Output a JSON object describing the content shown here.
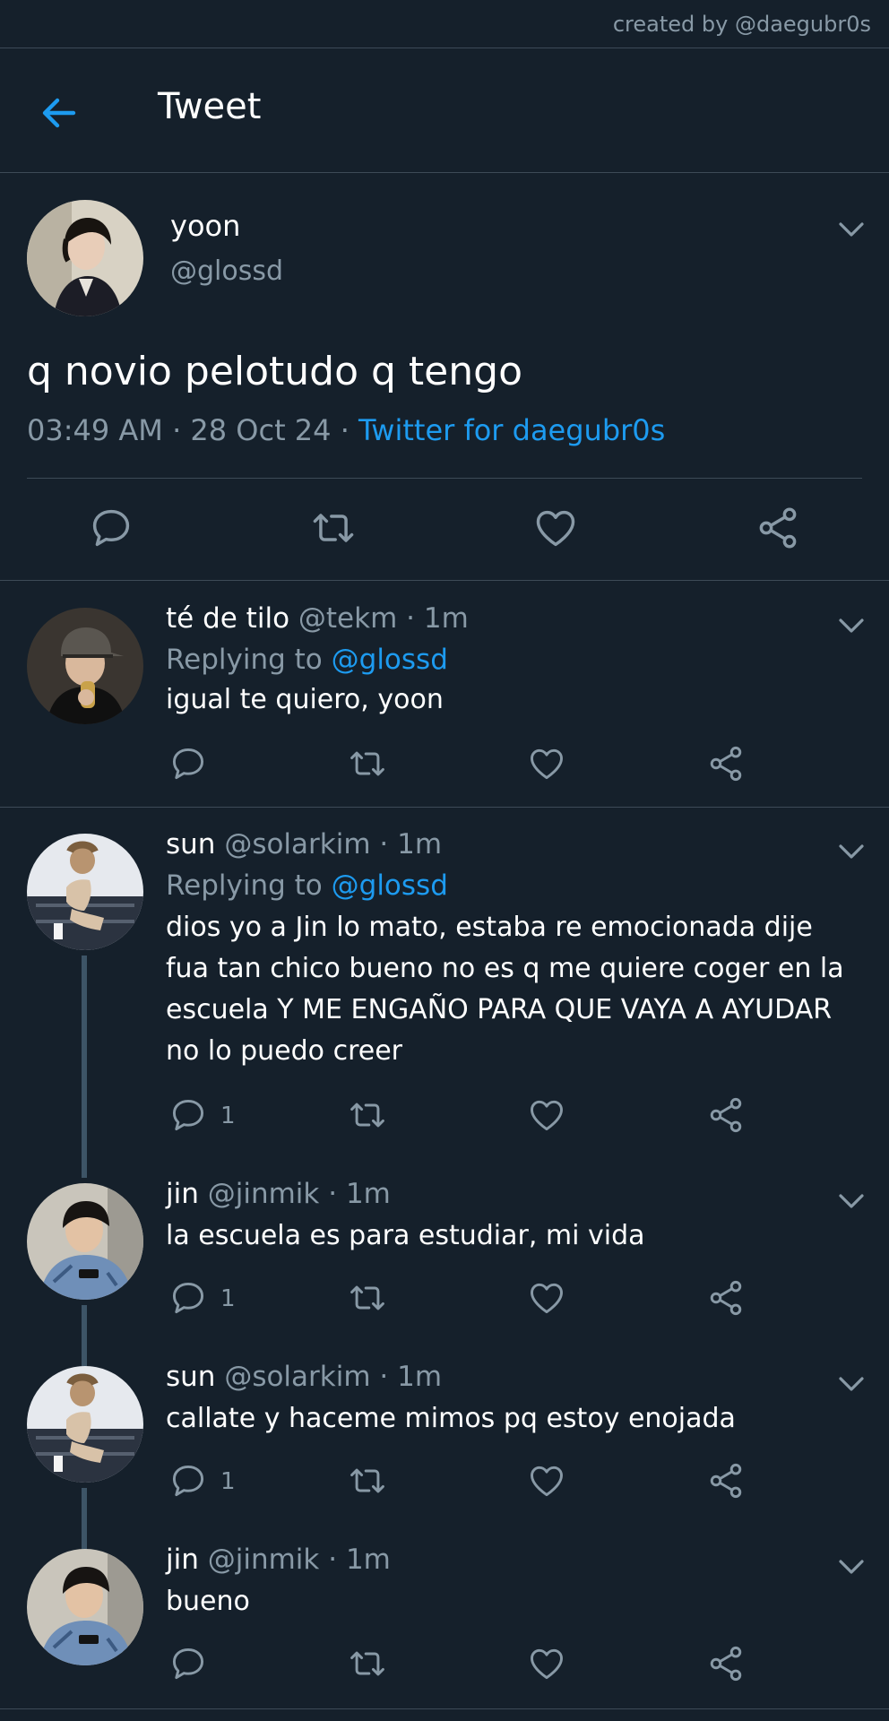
{
  "credit": "created by @daegubr0s",
  "header": {
    "title": "Tweet"
  },
  "main_tweet": {
    "name": "yoon",
    "handle": "@glossd",
    "text": "q novio pelotudo q tengo",
    "time": "03:49 AM",
    "date": "28 Oct 24",
    "sep": "·",
    "source": "Twitter for daegubr0s"
  },
  "replies": [
    {
      "name": "té de tilo",
      "handle": "@tekm",
      "time": "1m",
      "replying_prefix": "Replying to",
      "replying_to": "@glossd",
      "text": "igual te quiero, yoon",
      "reply_count": ""
    },
    {
      "name": "sun",
      "handle": "@solarkim",
      "time": "1m",
      "replying_prefix": "Replying to",
      "replying_to": "@glossd",
      "text": "dios yo a Jin lo mato, estaba re emocionada dije fua tan chico bueno no es q me quiere coger en la escuela Y ME ENGAÑO PARA QUE VAYA A AYUDAR no lo puedo creer",
      "reply_count": "1"
    },
    {
      "name": "jin",
      "handle": "@jinmik",
      "time": "1m",
      "text": "la escuela es para estudiar, mi vida",
      "reply_count": "1"
    },
    {
      "name": "sun",
      "handle": "@solarkim",
      "time": "1m",
      "text": "callate y haceme mimos pq estoy enojada",
      "reply_count": "1"
    },
    {
      "name": "jin",
      "handle": "@jinmik",
      "time": "1m",
      "text": "bueno",
      "reply_count": ""
    }
  ],
  "colors": {
    "background": "#15202b",
    "accent": "#1d9bf0",
    "muted": "#8899a6",
    "divider": "#3d4a57"
  },
  "icons": [
    "back-arrow-icon",
    "chevron-down-icon",
    "reply-icon",
    "retweet-icon",
    "like-icon",
    "share-icon"
  ]
}
